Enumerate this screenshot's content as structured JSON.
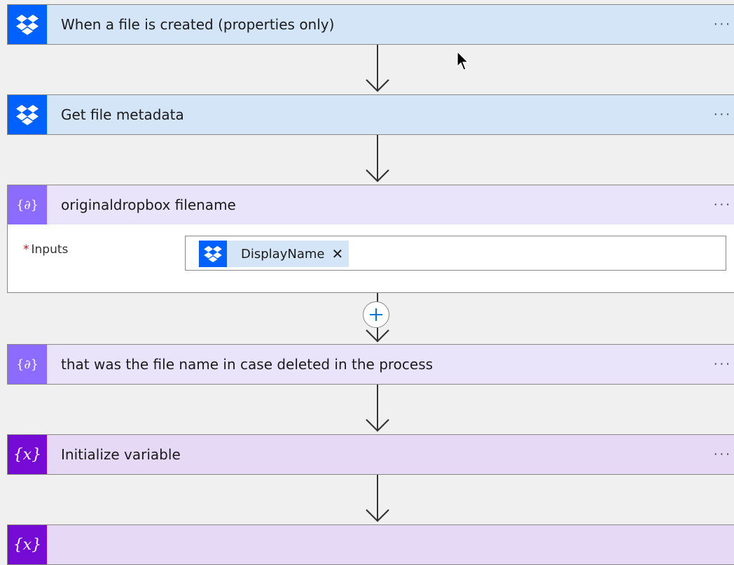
{
  "steps": [
    {
      "title": "When a file is created (properties only)",
      "icon": "dropbox-icon",
      "menu": "···"
    },
    {
      "title": "Get file metadata",
      "icon": "dropbox-icon",
      "menu": "···"
    },
    {
      "title": "originaldropbox filename",
      "icon": "compose-icon",
      "menu": "···",
      "param_label": "Inputs",
      "required_marker": "*",
      "token_label": "DisplayName",
      "token_remove": "✕"
    },
    {
      "title": "that was the file name in case deleted in the process",
      "icon": "compose-icon",
      "menu": "···"
    },
    {
      "title": "Initialize variable",
      "icon": "variable-icon",
      "menu": "···"
    }
  ],
  "glyphs": {
    "compose": "{∂}",
    "variable": "{x}",
    "plus": "+"
  },
  "colors": {
    "dropbox_blue": "#0061fe",
    "compose_purple": "#8c6cff",
    "variable_purple": "#770bd6",
    "plus_blue": "#0078d4"
  }
}
